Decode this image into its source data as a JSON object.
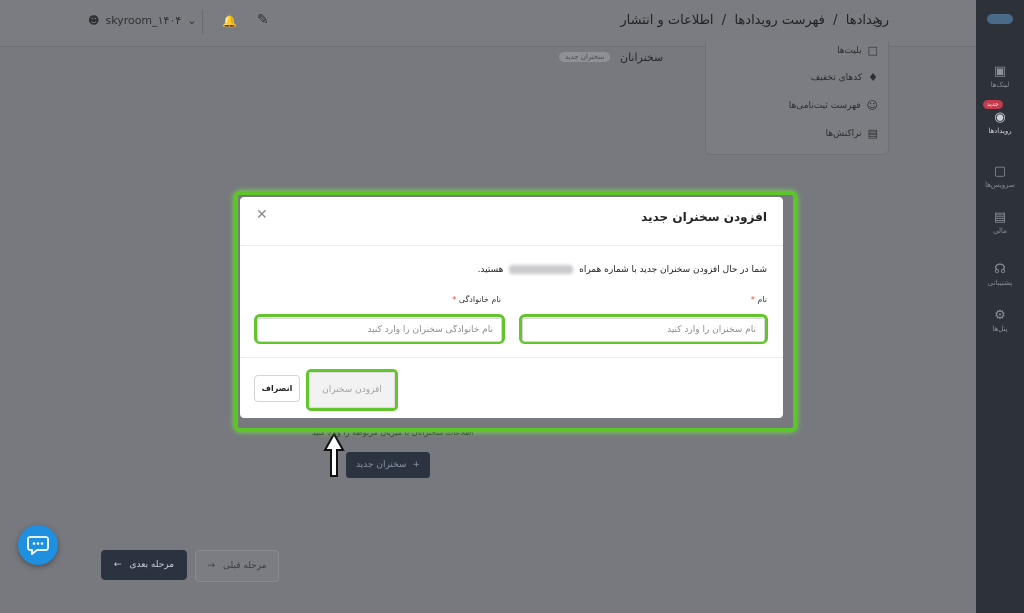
{
  "header": {
    "username": "skyroom_۱۴۰۴",
    "breadcrumb": [
      "رویدادها",
      "فهرست رویدادها",
      "اطلاعات و انتشار"
    ]
  },
  "sidebar": {
    "items": [
      {
        "label": "لینک‌ها",
        "icon": "link-icon"
      },
      {
        "label": "رویدادها",
        "icon": "location-icon",
        "active": true
      },
      {
        "label": "سرویس‌ها",
        "icon": "cube-icon"
      },
      {
        "label": "مالی",
        "icon": "card-icon"
      },
      {
        "label": "پشتیبانی",
        "icon": "headset-icon"
      },
      {
        "label": "پنل‌ها",
        "icon": "settings-icon"
      }
    ],
    "badge": "جدید"
  },
  "event_menu": [
    {
      "label": "بلیت‌ها",
      "icon": "ticket-icon"
    },
    {
      "label": "کدهای تخفیف",
      "icon": "tag-icon"
    },
    {
      "label": "فهرست ثبت‌نامی‌ها",
      "icon": "users-icon"
    },
    {
      "label": "تراکنش‌ها",
      "icon": "receipt-icon"
    }
  ],
  "speakers_section": {
    "title": "سخنرانان",
    "tag": "سخنران جدید",
    "hint": "اطلاعات سخنرانان با میزبان مربوطه را وارد کنید",
    "new_button": "سخنران جدید"
  },
  "footer": {
    "next": "مرحله بعدی",
    "prev": "مرحله قبلی"
  },
  "modal": {
    "title": "افزودن سخنران جدید",
    "desc_prefix": "شما در حال افزودن سخنران جدید با شماره همراه",
    "desc_suffix": "هستید.",
    "first_name": {
      "label": "نام",
      "placeholder": "نام سخنران را وارد کنید",
      "value": ""
    },
    "last_name": {
      "label": "نام خانوادگی",
      "placeholder": "نام خانوادگی سخنران را وارد کنید",
      "value": ""
    },
    "add_button": "افزودن سخنران",
    "cancel_button": "انصراف"
  },
  "colors": {
    "highlight": "#5cc629",
    "accent": "#1f8fe0",
    "dark_button": "#2c3340"
  }
}
